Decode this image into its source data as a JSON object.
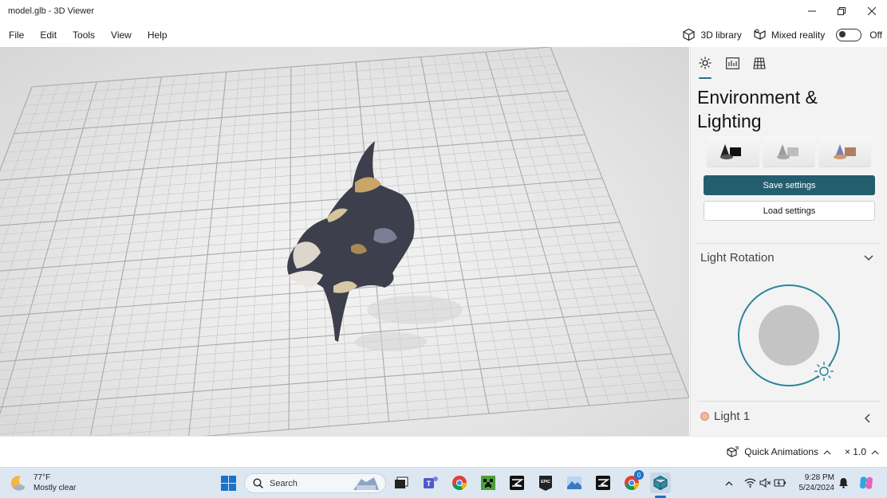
{
  "window": {
    "title": "model.glb - 3D Viewer"
  },
  "menu": {
    "items": [
      "File",
      "Edit",
      "Tools",
      "View",
      "Help"
    ],
    "library_label": "3D library",
    "mixed_reality_label": "Mixed reality",
    "toggle_state": "Off"
  },
  "panel": {
    "tabs": [
      "sun-icon",
      "stats-icon",
      "grid-icon"
    ],
    "heading_line1": "Environment &",
    "heading_line2": "Lighting",
    "presets": [
      "dark-preset",
      "neutral-preset",
      "warm-preset"
    ],
    "save_label": "Save settings",
    "load_label": "Load settings",
    "light_rotation_label": "Light Rotation",
    "light1_label": "Light 1"
  },
  "bottom": {
    "quick_animations_label": "Quick Animations",
    "speed_label": "× 1.0"
  },
  "taskbar": {
    "temperature": "77°F",
    "condition": "Mostly clear",
    "search_placeholder": "Search",
    "time": "9:28 PM",
    "date": "5/24/2024",
    "notification_badge": "0"
  },
  "colors": {
    "accent": "#245e6e",
    "dial_ring": "#2b8598",
    "taskbar_bg": "#dde7f1"
  }
}
